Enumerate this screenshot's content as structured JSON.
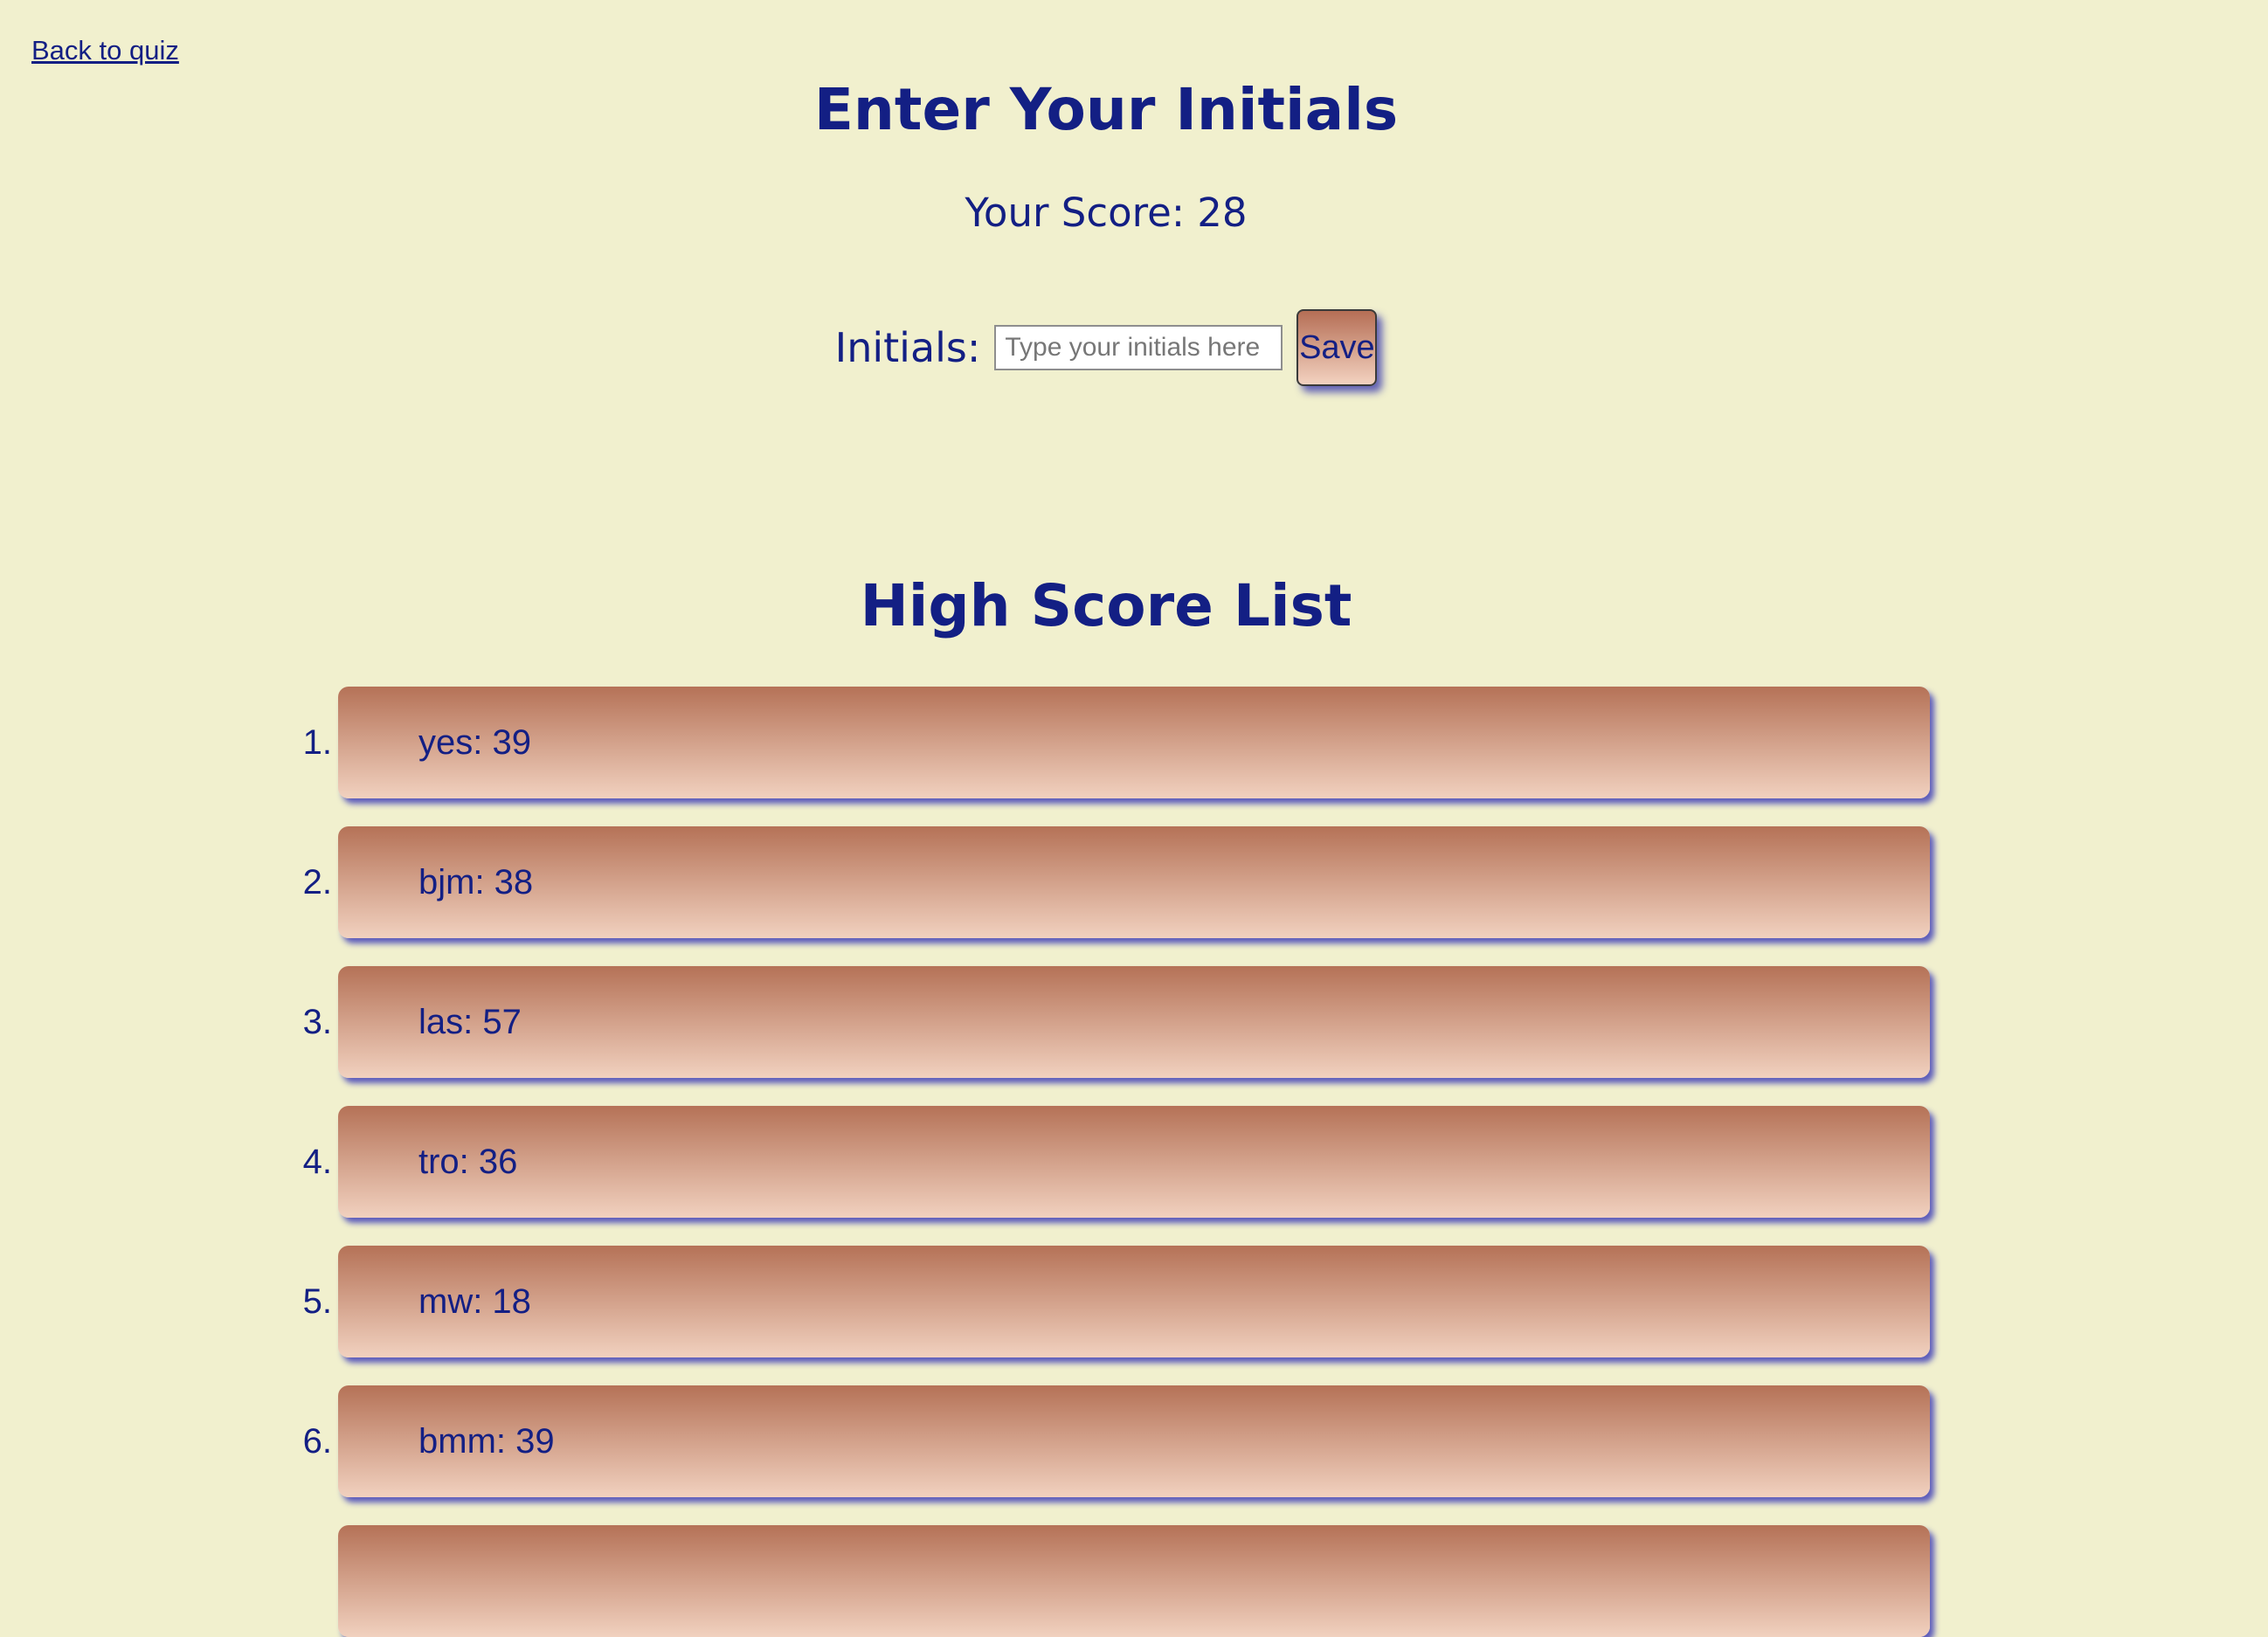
{
  "nav": {
    "back_label": "Back to quiz"
  },
  "header": {
    "title": "Enter Your Initials",
    "score_label": "Your Score: 28"
  },
  "form": {
    "initials_label": "Initials:",
    "initials_placeholder": "Type your initials here",
    "initials_value": "",
    "save_label": "Save"
  },
  "high_scores": {
    "title": "High Score List",
    "items": [
      {
        "number": "1.",
        "text": "yes: 39"
      },
      {
        "number": "2.",
        "text": "bjm: 38"
      },
      {
        "number": "3.",
        "text": "las: 57"
      },
      {
        "number": "4.",
        "text": "tro: 36"
      },
      {
        "number": "5.",
        "text": "mw: 18"
      },
      {
        "number": "6.",
        "text": "bmm: 39"
      },
      {
        "number": "",
        "text": ""
      }
    ]
  },
  "colors": {
    "background": "#f1f0ce",
    "text": "#131f84",
    "card_top": "#b57257",
    "card_bottom": "#f1d1bf",
    "shadow": "#2828b4"
  }
}
